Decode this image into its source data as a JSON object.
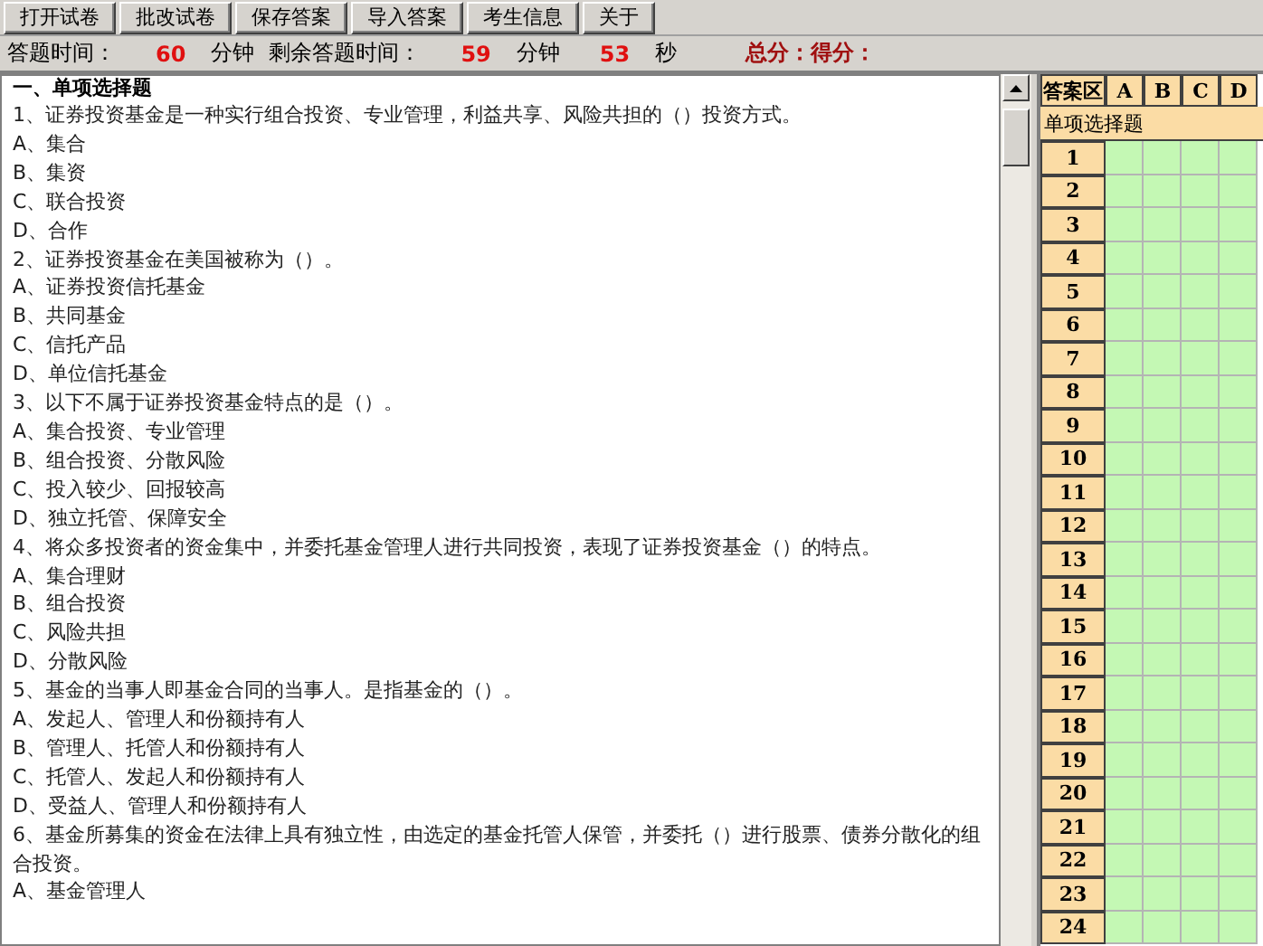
{
  "toolbar": {
    "buttons": [
      "打开试卷",
      "批改试卷",
      "保存答案",
      "导入答案",
      "考生信息",
      "关于"
    ]
  },
  "status_bar": {
    "items": [
      {
        "kind": "label",
        "text": "答题时间："
      },
      {
        "kind": "value",
        "text": "60"
      },
      {
        "kind": "label",
        "text": "分钟"
      },
      {
        "kind": "label",
        "text": "剩余答题时间："
      },
      {
        "kind": "value",
        "text": "59"
      },
      {
        "kind": "label",
        "text": "分钟"
      },
      {
        "kind": "value",
        "text": "53"
      },
      {
        "kind": "label",
        "text": "秒"
      },
      {
        "kind": "score",
        "text": "总分：得分："
      }
    ]
  },
  "paper": {
    "section_title": "一、单项选择题",
    "questions": [
      {
        "text": "1、证券投资基金是一种实行组合投资、专业管理，利益共享、风险共担的（）投资方式。",
        "options": [
          "A、集合",
          "B、集资",
          "C、联合投资",
          "D、合作"
        ]
      },
      {
        "text": "2、证券投资基金在美国被称为（）。",
        "options": [
          "A、证券投资信托基金",
          "B、共同基金",
          "C、信托产品",
          "D、单位信托基金"
        ]
      },
      {
        "text": "3、以下不属于证券投资基金特点的是（）。",
        "options": [
          "A、集合投资、专业管理",
          "B、组合投资、分散风险",
          "C、投入较少、回报较高",
          "D、独立托管、保障安全"
        ]
      },
      {
        "text": "4、将众多投资者的资金集中，并委托基金管理人进行共同投资，表现了证券投资基金（）的特点。",
        "options": [
          "A、集合理财",
          "B、组合投资",
          "C、风险共担",
          "D、分散风险"
        ]
      },
      {
        "text": "5、基金的当事人即基金合同的当事人。是指基金的（）。",
        "options": [
          "A、发起人、管理人和份额持有人",
          "B、管理人、托管人和份额持有人",
          "C、托管人、发起人和份额持有人",
          "D、受益人、管理人和份额持有人"
        ]
      },
      {
        "text": "6、基金所募集的资金在法律上具有独立性，由选定的基金托管人保管，并委托（）进行股票、债券分散化的组合投资。",
        "options": [
          "A、基金管理人"
        ]
      }
    ]
  },
  "answer_grid": {
    "columns": [
      "答案区",
      "A",
      "B",
      "C",
      "D"
    ],
    "section": "单项选择题",
    "rows": [
      "1",
      "2",
      "3",
      "4",
      "5",
      "6",
      "7",
      "8",
      "9",
      "10",
      "11",
      "12",
      "13",
      "14",
      "15",
      "16",
      "17",
      "18",
      "19",
      "20",
      "21",
      "22",
      "23",
      "24"
    ]
  }
}
